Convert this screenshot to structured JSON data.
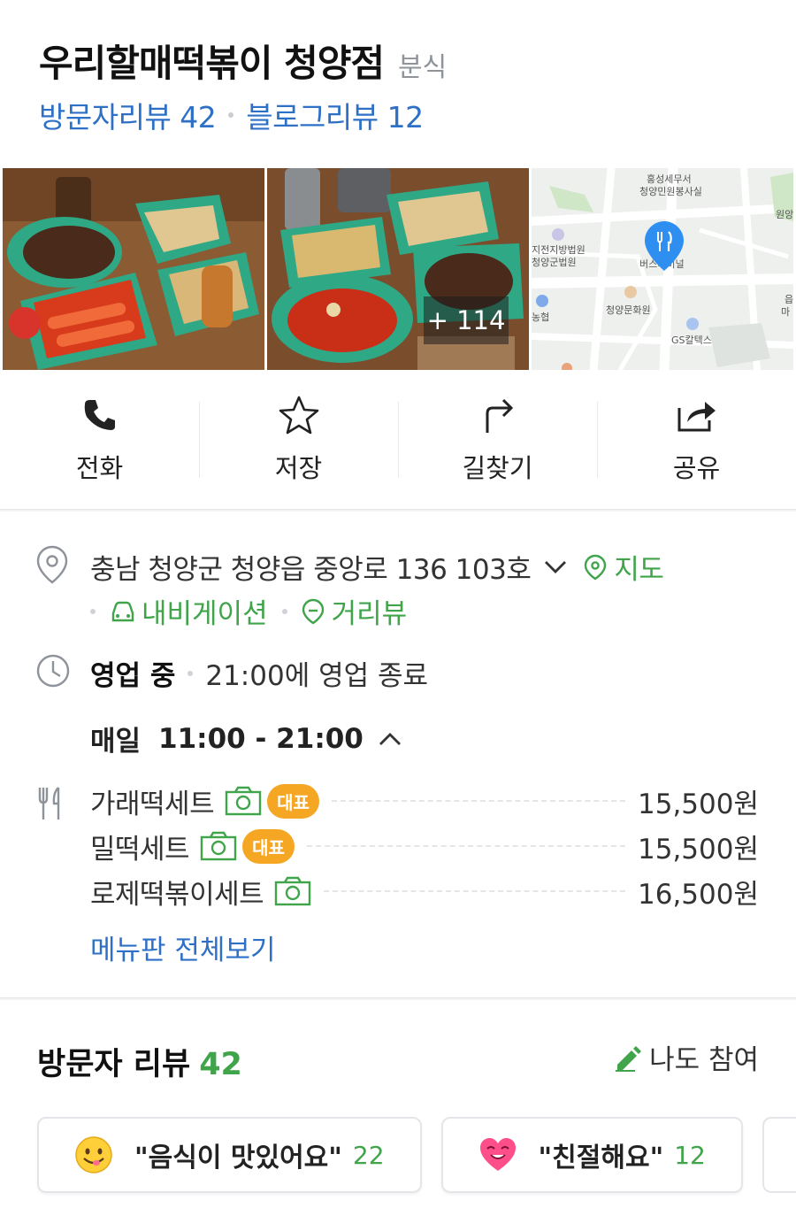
{
  "place": {
    "name": "우리할매떡볶이 청양점",
    "category": "분식",
    "visitor_review_link": "방문자리뷰 42",
    "blog_review_link": "블로그리뷰 12"
  },
  "photos": {
    "more_count": "+ 114",
    "map_labels": [
      "홍성세무서",
      "청양민원봉사실",
      "원앙",
      "지전지방법원",
      "청양군법원",
      "농협",
      "청양문화원",
      "GS칼텍스",
      "버스터미널",
      "읍",
      "마"
    ]
  },
  "actions": [
    {
      "label": "전화",
      "icon": "phone-icon"
    },
    {
      "label": "저장",
      "icon": "star-icon"
    },
    {
      "label": "길찾기",
      "icon": "directions-icon"
    },
    {
      "label": "공유",
      "icon": "share-icon"
    }
  ],
  "address": {
    "text": "충남 청양군 청양읍 중앙로 136 103호",
    "map_link": "지도",
    "navigation_link": "내비게이션",
    "streetview_link": "거리뷰"
  },
  "hours": {
    "status": "영업 중",
    "closing": "21:00에 영업 종료",
    "day": "매일",
    "time": "11:00 - 21:00"
  },
  "menu": {
    "items": [
      {
        "name": "가래떡세트",
        "badge": "대표",
        "price": "15,500원"
      },
      {
        "name": "밀떡세트",
        "badge": "대표",
        "price": "15,500원"
      },
      {
        "name": "로제떡볶이세트",
        "badge": "",
        "price": "16,500원"
      }
    ],
    "view_all": "메뉴판 전체보기"
  },
  "reviews": {
    "title": "방문자 리뷰",
    "count": "42",
    "join": "나도 참여",
    "chips": [
      {
        "text": "\"음식이 맛있어요\"",
        "count": "22",
        "icon": "yum-face-icon"
      },
      {
        "text": "\"친절해요\"",
        "count": "12",
        "icon": "heart-face-icon"
      }
    ]
  },
  "colors": {
    "link_blue": "#2d70c6",
    "green": "#3fa44a",
    "badge_orange": "#f5a623",
    "map_pin": "#2f8ff0"
  }
}
